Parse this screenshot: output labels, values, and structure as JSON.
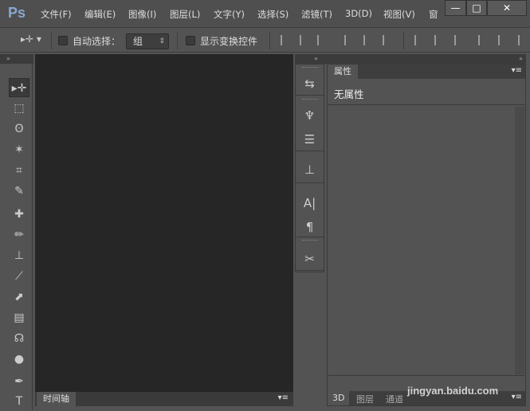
{
  "app": {
    "logo": "Ps"
  },
  "menu": [
    "文件(F)",
    "编辑(E)",
    "图像(I)",
    "图层(L)",
    "文字(Y)",
    "选择(S)",
    "滤镜(T)",
    "3D(D)",
    "视图(V)",
    "窗"
  ],
  "window_controls": {
    "minimize": "—",
    "maximize": "□",
    "close": "✕"
  },
  "options": {
    "auto_select_label": "自动选择：",
    "auto_select_value": "组",
    "show_transform_label": "显示变换控件",
    "auto_select_checked": false,
    "show_transform_checked": false
  },
  "collapse": {
    "left": "»",
    "middle": "«",
    "right": "»"
  },
  "tools": [
    "▸✛",
    "⬚",
    "ʘ",
    "✶",
    "⌗",
    "✎",
    "✚",
    "✏",
    "⊥",
    "⟋",
    "⬈",
    "▤",
    "☊",
    "●",
    "✒",
    "T"
  ],
  "strip_icons": [
    "history-icon",
    "brush-presets-icon",
    "adjustments-icon",
    "clone-source-icon",
    "character-icon",
    "paragraph-icon",
    "tool-presets-icon"
  ],
  "strip_glyphs": [
    "⇆",
    "♆",
    "☰",
    "⊥",
    "A|",
    "¶",
    "✂"
  ],
  "properties": {
    "tab": "属性",
    "content": "无属性",
    "menu": "▾≡"
  },
  "timeline": {
    "tab": "时间轴",
    "menu": "▾≡"
  },
  "bottom_tabs": [
    "3D",
    "图层",
    "通道"
  ],
  "bottom_menu": "▾≡",
  "watermark": "jingyan.baidu.com"
}
